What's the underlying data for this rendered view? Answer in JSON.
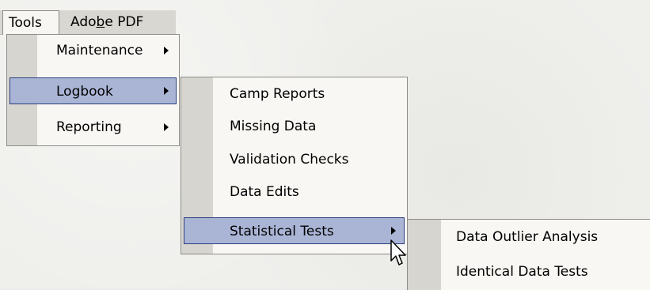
{
  "menubar": {
    "tools_label": "Tools",
    "adobe_label_pre": "Ado",
    "adobe_label_mnemonic": "b",
    "adobe_label_post": "e PDF"
  },
  "tools_menu": {
    "items": [
      {
        "label": "Maintenance",
        "has_submenu": true,
        "highlighted": false
      },
      {
        "label": "Logbook",
        "has_submenu": true,
        "highlighted": true
      },
      {
        "label": "Reporting",
        "has_submenu": true,
        "highlighted": false
      }
    ]
  },
  "logbook_menu": {
    "items": [
      {
        "label": "Camp Reports",
        "has_submenu": false,
        "highlighted": false
      },
      {
        "label": "Missing Data",
        "has_submenu": false,
        "highlighted": false
      },
      {
        "label": "Validation Checks",
        "has_submenu": false,
        "highlighted": false
      },
      {
        "label": "Data Edits",
        "has_submenu": false,
        "highlighted": false
      },
      {
        "label": "Statistical Tests",
        "has_submenu": true,
        "highlighted": true
      }
    ]
  },
  "statistical_tests_menu": {
    "items": [
      {
        "label": "Data Outlier Analysis",
        "highlighted": false
      },
      {
        "label": "Identical Data Tests",
        "highlighted": false
      }
    ]
  },
  "colors": {
    "highlight_fill": "#aab5d6",
    "highlight_border": "#2b3f7d",
    "menu_bg": "#f8f7f4",
    "gutter": "#d7d5cf"
  },
  "icons": {
    "submenu_arrow": "chevron-right-icon",
    "pointer": "mouse-cursor-icon"
  }
}
